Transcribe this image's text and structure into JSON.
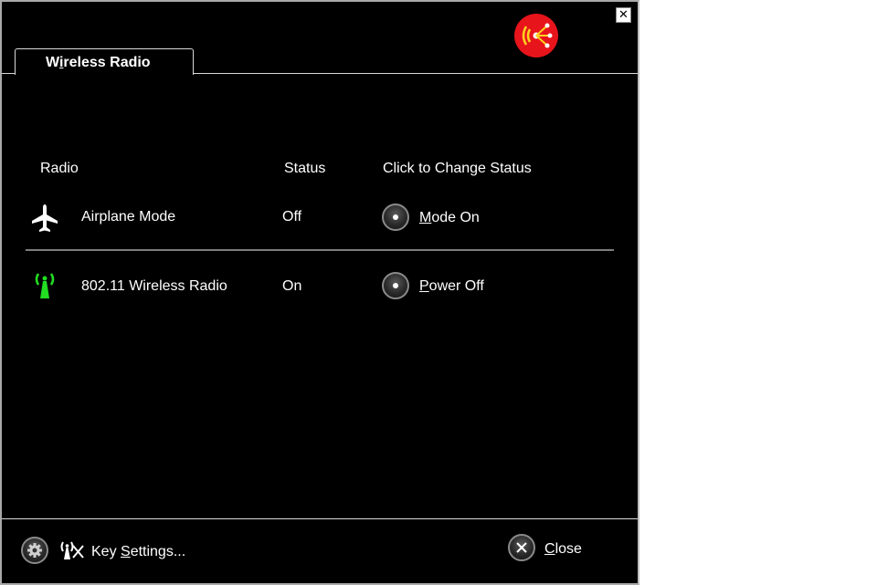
{
  "window": {
    "close_glyph": "✕"
  },
  "tab": {
    "label_pre": "W",
    "label_u": "i",
    "label_post": "reless Radio"
  },
  "table": {
    "headers": {
      "radio": "Radio",
      "status": "Status",
      "action": "Click to Change Status"
    },
    "rows": [
      {
        "icon": "airplane-icon",
        "name": "Airplane Mode",
        "status": "Off",
        "action_u": "M",
        "action_rest": "ode On"
      },
      {
        "icon": "wireless-antenna-icon",
        "name": "802.11 Wireless Radio",
        "status": "On",
        "action_u": "P",
        "action_rest": "ower Off"
      }
    ]
  },
  "footer": {
    "key_settings_pre": "Key ",
    "key_settings_u": "S",
    "key_settings_post": "ettings...",
    "close_u": "C",
    "close_post": "lose"
  },
  "colors": {
    "background": "#000000",
    "text": "#ffffff",
    "logo_red": "#e8141b",
    "logo_yellow": "#ffd21e",
    "antenna_green": "#22dd22"
  }
}
